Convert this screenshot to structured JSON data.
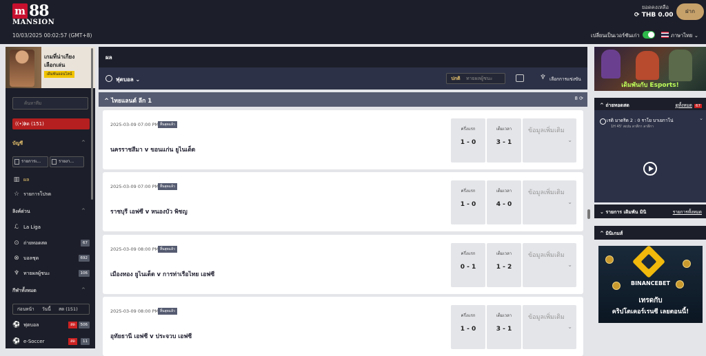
{
  "header": {
    "logo_mark": "m",
    "logo_number": "88",
    "logo_word": "MANSION",
    "datetime": "10/03/2025 00:02:57 (GMT+8)",
    "balance_label": "ยอดคงเหลือ",
    "balance_value": "THB 0.00",
    "deposit_label": "ฝาก",
    "classic_label": "เปลี่ยนเป็นเวอร์ชันเก่า",
    "language": "ภาษาไทย"
  },
  "sidebar": {
    "promo_line1": "เกมที่น่าเกียง",
    "promo_line2": "เลือกเล่น",
    "promo_button": "เดิมพันออนไลน์",
    "search_placeholder": "ค้นหาทีม",
    "live_label": "สด (151)",
    "account_section": "บัญชี",
    "btn_statement1": "รายการเ...",
    "btn_statement2": "รายงา...",
    "results_label": "ผล",
    "favorites_label": "รายการโปรด",
    "quicklinks_section": "ลิงค์ด่วน",
    "quicklinks": [
      {
        "icon": "laliga-icon",
        "label": "La Liga",
        "count": ""
      },
      {
        "icon": "play-circle-icon",
        "label": "ถ่ายทอดสด",
        "count": "67"
      },
      {
        "icon": "parlay-icon",
        "label": "บอลชุด",
        "count": "692"
      },
      {
        "icon": "trophy-icon",
        "label": "ทายผลผู้ชนะ",
        "count": "106"
      }
    ],
    "allsports_section": "กีฬาทั้งหมด",
    "tab_early": "ก่อนหน้า",
    "tab_today": "วันนี้",
    "tab_live": "สด (151)",
    "sports": [
      {
        "icon": "soccer-icon",
        "label": "ฟุตบอล",
        "live": "สด",
        "count": "506"
      },
      {
        "icon": "esoccer-icon",
        "label": "e-Soccer",
        "live": "สด",
        "count": "11"
      }
    ]
  },
  "main": {
    "title": "ผล",
    "sport": "ฟุตบอล",
    "seg_normal": "ปกติ",
    "seg_winner": "ทายผลผู้ชนะ",
    "competitions_label": "เลือกการแข่งขัน",
    "league": "ไทยแลนด์ ลีก 1",
    "league_count": "8",
    "ht_label": "ครึ่งแรก",
    "ft_label": "เต็มเวลา",
    "more_label": "ข้อมูลเพิ่มเติม",
    "matches": [
      {
        "datetime": "2025-03-09 07:00 PM",
        "badge": "สิ้นสุดแล้ว",
        "teams": "นครราชสีมา  v  ขอนแก่น ยูไนเต็ด",
        "ht": "1 - 0",
        "ft": "3 - 1"
      },
      {
        "datetime": "2025-03-09 07:00 PM",
        "badge": "สิ้นสุดแล้ว",
        "teams": "ราชบุรี เอฟซี  v  หนองบัว พิชญ",
        "ht": "1 - 0",
        "ft": "4 - 0"
      },
      {
        "datetime": "2025-03-09 08:00 PM",
        "badge": "สิ้นสุดแล้ว",
        "teams": "เมืองทอง ยูไนเต็ด  v  การท่าเรือไทย เอฟซี",
        "ht": "0 - 1",
        "ft": "1 - 2"
      },
      {
        "datetime": "2025-03-09 08:00 PM",
        "badge": "สิ้นสุดแล้ว",
        "teams": "อุทัยธานี เอฟซี  v  ประจวบ เอฟซี",
        "ht": "1 - 0",
        "ft": "3 - 1"
      }
    ]
  },
  "right": {
    "esports_text": "เดิมพันกับ Esports!",
    "live_title": "ถ่ายทอดสด",
    "live_link": "ดูทั้งหมด",
    "live_count": "67",
    "stream_title": "เรดิ มาดริด 2 : 0 ราโย บาเยกาโน่",
    "stream_sub": "1H 45' สเปน ลาลีกา ลาลีกา",
    "upcoming_title": "รายการ เดิมพัน มินิ",
    "upcoming_link": "รายการทั้งหมด",
    "minigames_title": "มินิเกมส์",
    "binance_brand": "BINANCEBET",
    "binance_line1": "เทรดกับ",
    "binance_line2": "คริปโตเคอร์เรนซี เลยตอนนี้!"
  }
}
